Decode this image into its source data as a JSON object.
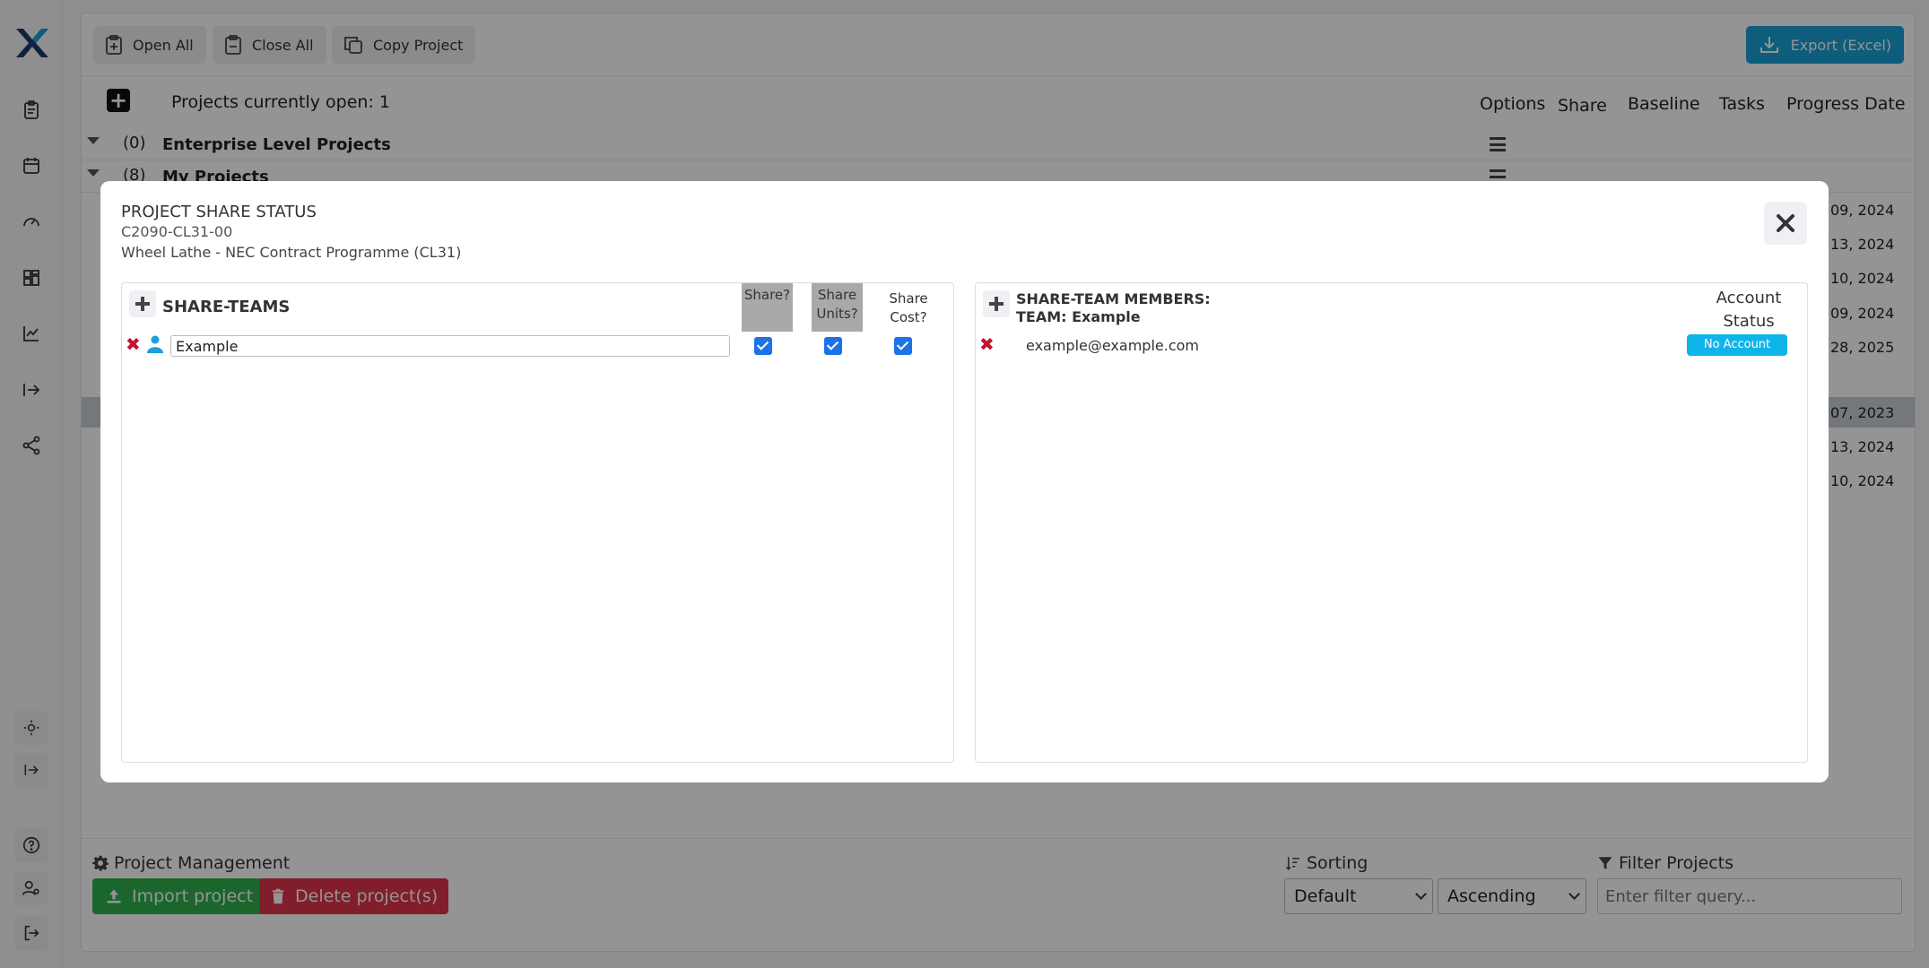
{
  "toolbar": {
    "open_all": "Open All",
    "close_all": "Close All",
    "copy_project": "Copy Project",
    "export": "Export (Excel)"
  },
  "projects": {
    "open_count": "Projects currently open: 1",
    "columns": [
      "Options",
      "Share",
      "Baseline",
      "Tasks",
      "Progress Date"
    ],
    "groups": [
      {
        "count": "(0)",
        "name": "Enterprise Level Projects"
      },
      {
        "count": "(8)",
        "name": "My Projects"
      }
    ],
    "dates": [
      "09, 2024",
      "13, 2024",
      "10, 2024",
      "09, 2024",
      "28, 2025",
      "07, 2023",
      "13, 2024",
      "10, 2024"
    ]
  },
  "footer": {
    "project_management": "Project Management",
    "import": "Import project",
    "delete": "Delete project(s)",
    "sorting": "Sorting",
    "sort_field": "Default",
    "sort_order": "Ascending",
    "filter_label": "Filter Projects",
    "filter_placeholder": "Enter filter query..."
  },
  "modal": {
    "title": "PROJECT SHARE STATUS",
    "code": "C2090-CL31-00",
    "project_name": "Wheel Lathe - NEC Contract Programme (CL31)",
    "teams": {
      "title": "SHARE-TEAMS",
      "col_share": "Share?",
      "col_units": "Share Units?",
      "col_cost": "Share Cost?",
      "rows": [
        {
          "name": "Example",
          "share": true,
          "units": true,
          "cost": true
        }
      ]
    },
    "members": {
      "title_line1": "SHARE-TEAM MEMBERS:",
      "title_line2": "TEAM: Example",
      "account_status": "Account Status",
      "rows": [
        {
          "email": "example@example.com",
          "status": "No Account"
        }
      ]
    }
  },
  "colors": {
    "accent": "#1aa0d8",
    "import": "#2fb04e",
    "delete": "#e0354b",
    "no_account": "#0fb4ea",
    "remove": "#c0142f"
  }
}
